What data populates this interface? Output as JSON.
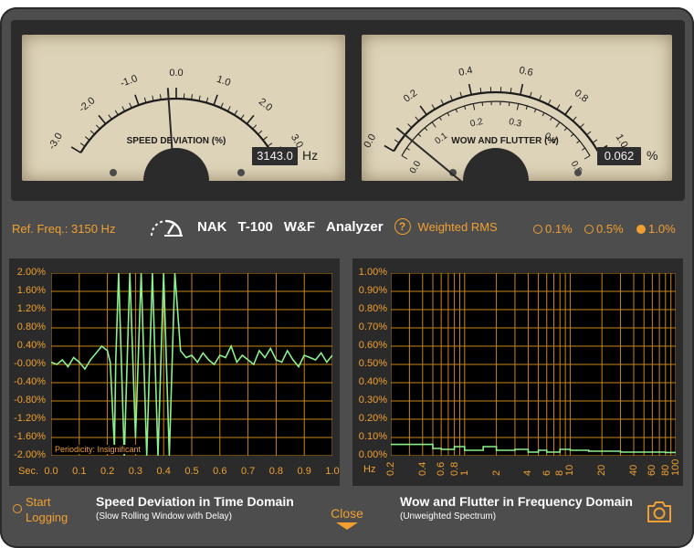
{
  "meters": {
    "speed": {
      "title": "SPEED DEVIATION (%)",
      "scale_labels": [
        "-3.0",
        "-2.0",
        "-1.0",
        "0.0",
        "1.0",
        "2.0",
        "3.0"
      ],
      "needle_value": -0.2,
      "readout": "3143.0",
      "unit": "Hz"
    },
    "wow": {
      "title": "WOW AND FLUTTER (%)",
      "outer_labels": [
        "0.0",
        "0.2",
        "0.4",
        "0.6",
        "0.8",
        "1.0"
      ],
      "inner_labels": [
        "0.0",
        "0.1",
        "0.2",
        "0.3",
        "0.4",
        "0.5"
      ],
      "needle_value": 0.08,
      "readout": "0.062",
      "unit": "%"
    }
  },
  "status": {
    "ref_freq": "Ref. Freq.: 3150 Hz",
    "brand": "NAK",
    "model": "T-100",
    "wf": "W&F",
    "analyzer": "Analyzer",
    "help": "?",
    "weighting": "Weighted RMS",
    "scale_options": [
      {
        "label": "0.1%",
        "selected": false
      },
      {
        "label": "0.5%",
        "selected": false
      },
      {
        "label": "1.0%",
        "selected": true
      }
    ]
  },
  "time_graph": {
    "y_labels": [
      "2.00%",
      "1.60%",
      "1.20%",
      "0.80%",
      "0.40%",
      "-0.00%",
      "-0.40%",
      "-0.80%",
      "-1.20%",
      "-1.60%",
      "-2.00%"
    ],
    "x_axis_label": "Sec.",
    "x_labels": [
      "0.0",
      "0.1",
      "0.2",
      "0.3",
      "0.4",
      "0.5",
      "0.6",
      "0.7",
      "0.8",
      "0.9",
      "1.0"
    ],
    "periodicity": "Periodicity: Insignificant",
    "title": "Speed Deviation in Time Domain",
    "subtitle": "(Slow Rolling Window with Delay)"
  },
  "freq_graph": {
    "y_labels": [
      "1.00%",
      "0.90%",
      "0.80%",
      "0.70%",
      "0.60%",
      "0.50%",
      "0.40%",
      "0.30%",
      "0.20%",
      "0.10%",
      "0.00%"
    ],
    "x_axis_label": "Hz",
    "x_labels": [
      "0.2",
      "0.4",
      "0.6",
      "0.8",
      "1",
      "2",
      "4",
      "6",
      "8",
      "10",
      "20",
      "40",
      "60",
      "80",
      "100"
    ],
    "title": "Wow and Flutter in Frequency Domain",
    "subtitle": "(Unweighted Spectrum)"
  },
  "controls": {
    "start_line1": "Start",
    "start_line2": "Logging",
    "close": "Close"
  },
  "chart_data": [
    {
      "type": "line",
      "title": "Speed Deviation in Time Domain",
      "xlabel": "Sec.",
      "ylabel": "",
      "xlim": [
        0.0,
        1.0
      ],
      "ylim": [
        -2.0,
        2.0
      ],
      "grid": true,
      "series": [
        {
          "x": [
            0.0,
            0.02,
            0.04,
            0.06,
            0.08,
            0.1,
            0.12,
            0.14,
            0.16,
            0.18,
            0.2,
            0.21,
            0.22,
            0.225,
            0.23,
            0.24,
            0.26,
            0.28,
            0.3,
            0.32,
            0.34,
            0.36,
            0.38,
            0.4,
            0.42,
            0.44,
            0.46,
            0.48,
            0.5,
            0.52,
            0.54,
            0.56,
            0.58,
            0.6,
            0.62,
            0.64,
            0.66,
            0.68,
            0.7,
            0.72,
            0.74,
            0.76,
            0.78,
            0.8,
            0.82,
            0.84,
            0.86,
            0.88,
            0.9,
            0.92,
            0.94,
            0.96,
            0.98,
            1.0
          ],
          "y": [
            0.05,
            0.0,
            0.1,
            -0.05,
            0.15,
            0.05,
            -0.1,
            0.1,
            0.25,
            0.4,
            0.3,
            0.05,
            -1.2,
            -1.8,
            0.1,
            2.0,
            -2.0,
            2.0,
            -1.6,
            2.0,
            -2.0,
            2.0,
            -2.0,
            2.0,
            -2.0,
            2.0,
            0.3,
            0.15,
            0.2,
            0.05,
            0.25,
            0.1,
            0.0,
            0.2,
            0.15,
            0.4,
            0.05,
            0.2,
            0.1,
            0.0,
            0.3,
            0.15,
            0.35,
            0.1,
            0.05,
            0.3,
            0.1,
            -0.05,
            0.2,
            0.15,
            0.1,
            0.25,
            0.05,
            0.2
          ]
        }
      ]
    },
    {
      "type": "line",
      "title": "Wow and Flutter in Frequency Domain",
      "xlabel": "Hz",
      "ylabel": "",
      "x_scale": "log",
      "xlim": [
        0.2,
        100
      ],
      "ylim": [
        0.0,
        1.0
      ],
      "grid": true,
      "series": [
        {
          "x": [
            0.2,
            0.4,
            0.5,
            0.6,
            0.8,
            1,
            1.5,
            2,
            3,
            4,
            5,
            6,
            8,
            10,
            15,
            20,
            30,
            40,
            60,
            80,
            100
          ],
          "y": [
            0.062,
            0.062,
            0.04,
            0.035,
            0.05,
            0.03,
            0.05,
            0.03,
            0.035,
            0.02,
            0.03,
            0.02,
            0.035,
            0.03,
            0.025,
            0.025,
            0.02,
            0.02,
            0.02,
            0.018,
            0.02
          ]
        }
      ]
    }
  ]
}
